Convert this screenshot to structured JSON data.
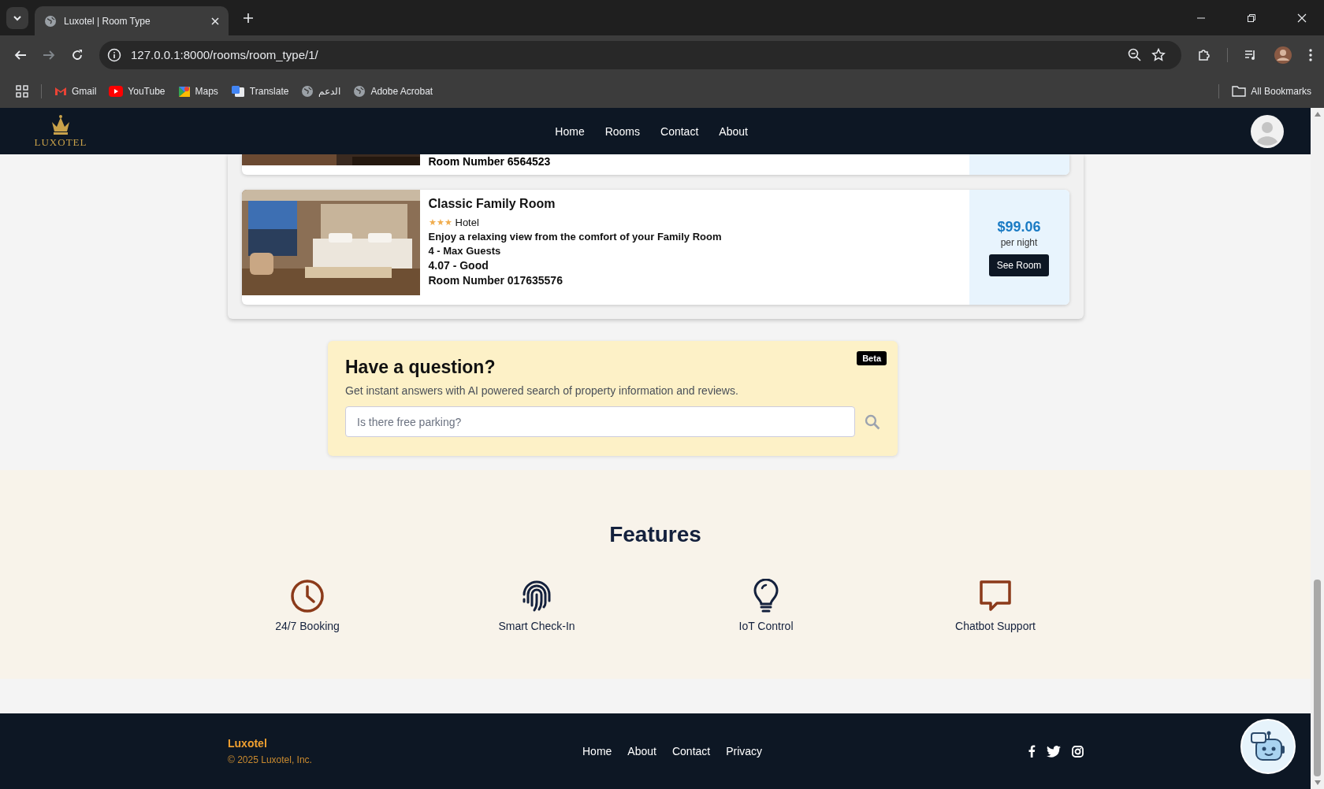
{
  "browser": {
    "tab_title": "Luxotel | Room Type",
    "url": "127.0.0.1:8000/rooms/room_type/1/",
    "bookmarks": [
      {
        "label": "Gmail",
        "kind": "mail"
      },
      {
        "label": "YouTube",
        "kind": "play"
      },
      {
        "label": "Maps",
        "kind": "map"
      },
      {
        "label": "Translate",
        "kind": "translate"
      },
      {
        "label": "الدعم",
        "kind": "globe"
      },
      {
        "label": "Adobe Acrobat",
        "kind": "globe"
      }
    ],
    "all_bookmarks": "All Bookmarks"
  },
  "nav": {
    "logo": "LUXOTEL",
    "links": [
      "Home",
      "Rooms",
      "Contact",
      "About"
    ]
  },
  "partial_room": {
    "room_number": "Room Number 6564523"
  },
  "room": {
    "name": "Classic Family Room",
    "stars": 3,
    "category": "Hotel",
    "description": "Enjoy a relaxing view from the comfort of your Family Room",
    "guests": "4 - Max Guests",
    "rating": "4.07 - Good",
    "room_number": "Room Number 017635576",
    "price": "$99.06",
    "price_unit": "per night",
    "button": "See Room"
  },
  "question": {
    "title": "Have a question?",
    "badge": "Beta",
    "subtitle": "Get instant answers with AI powered search of property information and reviews.",
    "placeholder": "Is there free parking?"
  },
  "features": {
    "title": "Features",
    "items": [
      {
        "label": "24/7 Booking",
        "kind": "clock"
      },
      {
        "label": "Smart Check-In",
        "kind": "fingerprint"
      },
      {
        "label": "IoT Control",
        "kind": "bulb"
      },
      {
        "label": "Chatbot Support",
        "kind": "chat"
      }
    ]
  },
  "footer": {
    "brand": "Luxotel",
    "copyright": "© 2025 Luxotel, Inc.",
    "links": [
      "Home",
      "About",
      "Contact",
      "Privacy"
    ]
  }
}
